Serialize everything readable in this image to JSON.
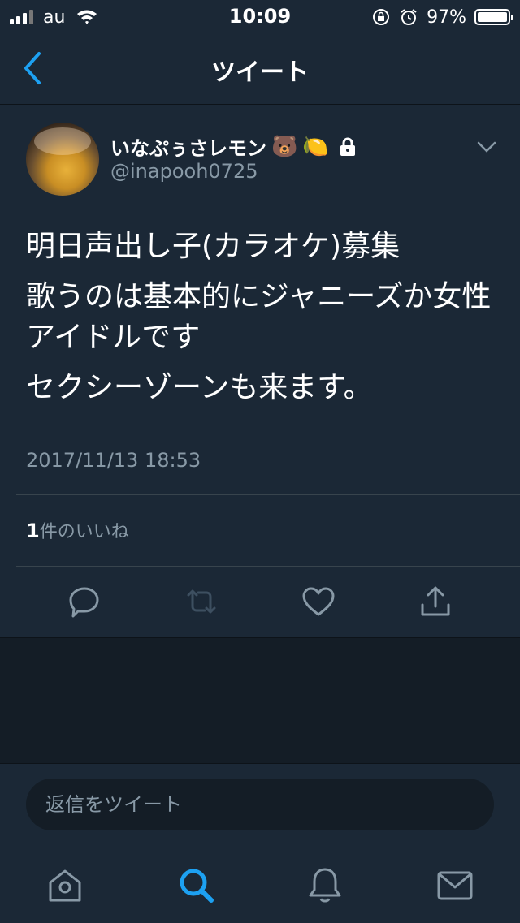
{
  "status_bar": {
    "carrier": "au",
    "time": "10:09",
    "battery": "97%"
  },
  "nav": {
    "title": "ツイート",
    "back_icon": "chevron-left-icon"
  },
  "tweet": {
    "display_name": "いなぷぅさレモン",
    "emojis": [
      "🐻",
      "🍋"
    ],
    "handle": "@inapooh0725",
    "lines": [
      "明日声出し子(カラオケ)募集",
      "歌うのは基本的にジャニーズか女性アイドルです",
      "セクシーゾーンも来ます。"
    ],
    "timestamp": "2017/11/13 18:53",
    "likes_count": "1",
    "likes_label": "件のいいね"
  },
  "reply": {
    "placeholder": "返信をツイート"
  },
  "colors": {
    "background": "#141d26",
    "panel": "#1b2836",
    "secondary_text": "#8899a6",
    "accent": "#1da1f2"
  },
  "tabs": [
    "home-icon",
    "search-icon",
    "notifications-icon",
    "messages-icon"
  ]
}
